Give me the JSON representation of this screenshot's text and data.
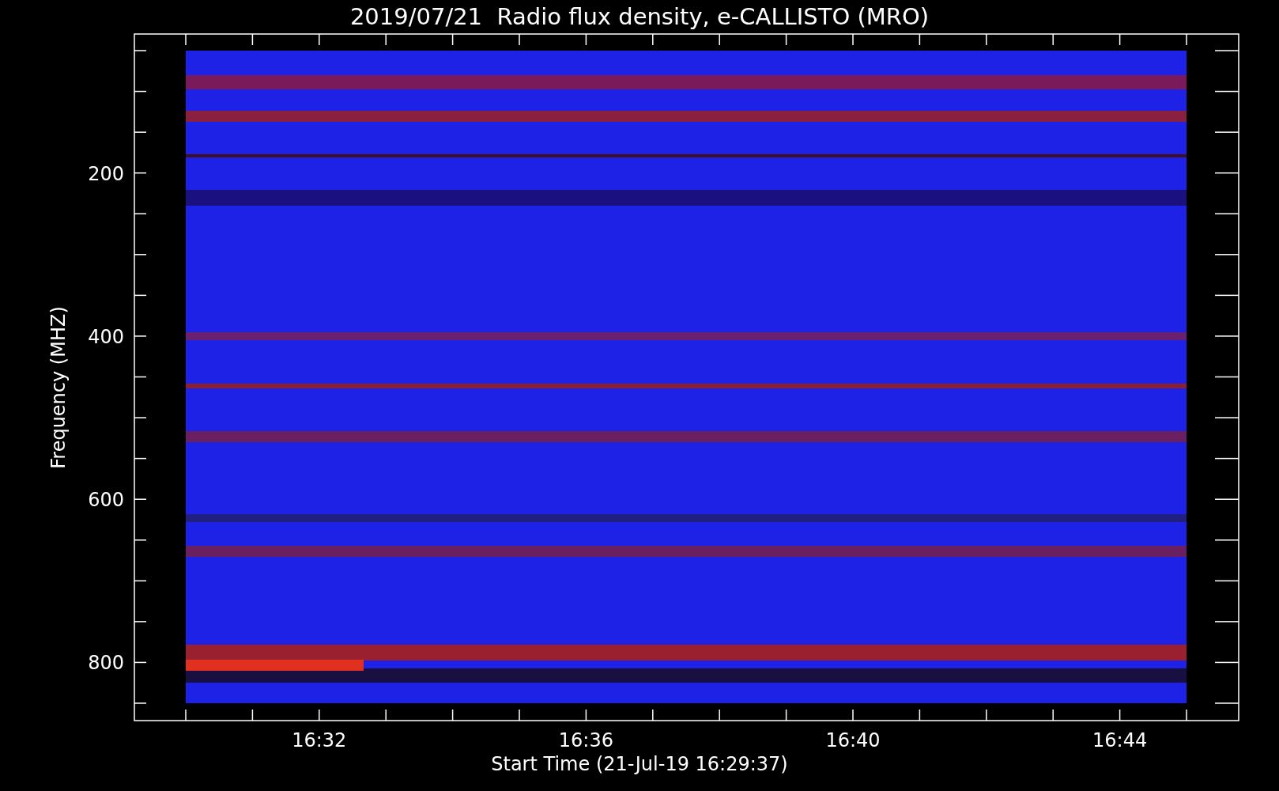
{
  "title": "2019/07/21  Radio flux density, e-CALLISTO (MRO)",
  "y_axis": {
    "label": "Frequency (MHZ)",
    "ticks": [
      "200",
      "400",
      "600",
      "800"
    ]
  },
  "x_axis": {
    "label": "Start Time (21-Jul-19 16:29:37)",
    "ticks": [
      "16:32",
      "16:36",
      "16:40",
      "16:44"
    ]
  }
}
